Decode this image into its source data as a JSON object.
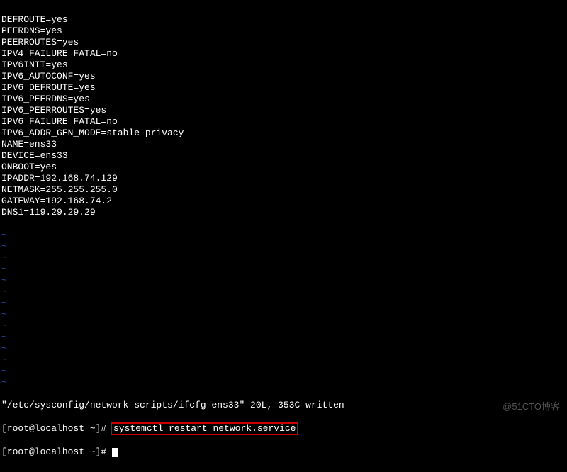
{
  "config_lines": [
    "DEFROUTE=yes",
    "PEERDNS=yes",
    "PEERROUTES=yes",
    "IPV4_FAILURE_FATAL=no",
    "IPV6INIT=yes",
    "IPV6_AUTOCONF=yes",
    "IPV6_DEFROUTE=yes",
    "IPV6_PEERDNS=yes",
    "IPV6_PEERROUTES=yes",
    "IPV6_FAILURE_FATAL=no",
    "IPV6_ADDR_GEN_MODE=stable-privacy",
    "NAME=ens33",
    "DEVICE=ens33",
    "ONBOOT=yes",
    "IPADDR=192.168.74.129",
    "NETMASK=255.255.255.0",
    "GATEWAY=192.168.74.2",
    "DNS1=119.29.29.29"
  ],
  "tilde_count": 14,
  "tilde_char": "~",
  "status_line": "\"/etc/sysconfig/network-scripts/ifcfg-ens33\" 20L, 353C written",
  "prompt1": {
    "prefix": "[root@localhost ~]# ",
    "command": "systemctl restart network.service"
  },
  "prompt2": {
    "prefix": "[root@localhost ~]# "
  },
  "watermark": "@51CTO博客"
}
